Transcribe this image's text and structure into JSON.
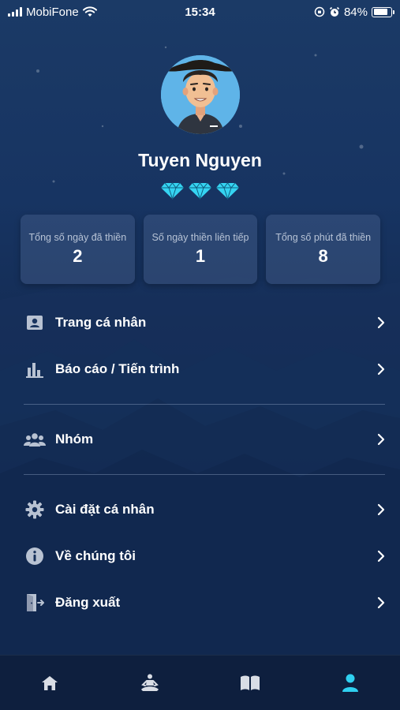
{
  "status_bar": {
    "carrier": "MobiFone",
    "time": "15:34",
    "battery": "84%",
    "battery_level": 0.84,
    "icons": [
      "signal-icon",
      "wifi-icon",
      "orientation-lock-icon",
      "alarm-icon",
      "battery-icon"
    ]
  },
  "profile": {
    "name": "Tuyen Nguyen",
    "gem_count": 3,
    "gem_color": "#35d4f2"
  },
  "stats": [
    {
      "label": "Tổng số ngày đã thiền",
      "value": "2"
    },
    {
      "label": "Số ngày thiền liên tiếp",
      "value": "1"
    },
    {
      "label": "Tổng số phút đã thiền",
      "value": "8"
    }
  ],
  "menu": [
    {
      "label": "Trang cá nhân",
      "icon": "profile-card-icon"
    },
    {
      "label": "Báo cáo / Tiến trình",
      "icon": "bar-chart-icon"
    },
    {
      "label": "Nhóm",
      "icon": "group-icon"
    },
    {
      "label": "Cài đặt cá nhân",
      "icon": "gear-icon"
    },
    {
      "label": "Về chúng tôi",
      "icon": "info-icon"
    },
    {
      "label": "Đăng xuất",
      "icon": "logout-icon"
    }
  ],
  "tabbar": {
    "tabs": [
      {
        "icon": "home-icon",
        "active": false
      },
      {
        "icon": "meditation-icon",
        "active": false
      },
      {
        "icon": "book-icon",
        "active": false
      },
      {
        "icon": "user-icon",
        "active": true
      }
    ],
    "active_color": "#2fd0f0",
    "inactive_color": "#d9dde5"
  },
  "colors": {
    "background": "#10264a",
    "card": "#3a5078",
    "accent": "#2fd0f0"
  }
}
